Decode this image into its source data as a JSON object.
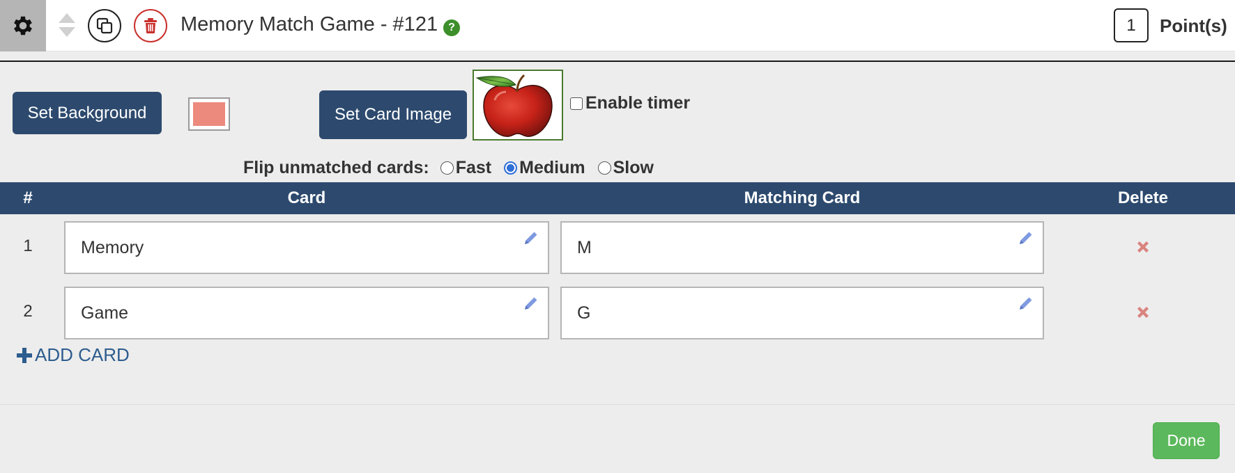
{
  "header": {
    "title": "Memory Match Game - #121",
    "help_icon": "?",
    "points_value": "1",
    "points_label": "Point(s)",
    "icons": [
      "gear-icon",
      "sort-arrows-icon",
      "copy-icon",
      "trash-icon",
      "help-icon"
    ]
  },
  "settings": {
    "set_background_label": "Set Background",
    "background_color": "#ec8a7d",
    "set_card_image_label": "Set Card Image",
    "card_image": "apple-image",
    "enable_timer_label": "Enable timer",
    "enable_timer_checked": false,
    "flip_label": "Flip unmatched cards:",
    "flip_options": [
      {
        "label": "Fast",
        "checked": false
      },
      {
        "label": "Medium",
        "checked": true
      },
      {
        "label": "Slow",
        "checked": false
      }
    ]
  },
  "table": {
    "headers": {
      "num": "#",
      "card": "Card",
      "matching": "Matching Card",
      "delete": "Delete"
    },
    "rows": [
      {
        "num": "1",
        "card": "Memory",
        "matching": "M"
      },
      {
        "num": "2",
        "card": "Game",
        "matching": "G"
      }
    ]
  },
  "add_card_label": "ADD CARD",
  "done_label": "Done",
  "colors": {
    "navy": "#2d4a6e",
    "done_green": "#5cb85c",
    "delete_red": "#d9837f",
    "pencil_blue": "#7f9ae0",
    "help_green": "#3c8f2a"
  }
}
